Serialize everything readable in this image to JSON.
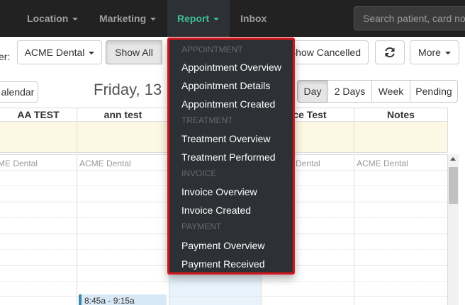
{
  "navbar": {
    "items": [
      {
        "label": "Location"
      },
      {
        "label": "Marketing"
      },
      {
        "label": "Report"
      },
      {
        "label": "Inbox"
      }
    ],
    "search_placeholder": "Search patient, card no"
  },
  "toolbar": {
    "filter_label": "er:",
    "clinic_select": "ACME Dental",
    "show_all": "Show All",
    "show_cancelled": "Show Cancelled",
    "more": "More",
    "refresh_icon": "refresh-icon"
  },
  "calendar": {
    "calendar_button": "alendar",
    "date_title": "Friday, 13",
    "views": [
      "Day",
      "2 Days",
      "Week",
      "Pending"
    ],
    "columns": [
      "AA TEST",
      "ann test",
      "",
      "ctice Test",
      "Notes"
    ],
    "clinic_labels": [
      "ME Dental",
      "ACME Dental",
      "",
      "Dental",
      "ACME Dental"
    ],
    "event_time": "8:45a - 9:15a"
  },
  "report_menu": {
    "sections": [
      {
        "header": "APPOINTMENT",
        "items": [
          "Appointment Overview",
          "Appointment Details",
          "Appointment Created"
        ]
      },
      {
        "header": "TREATMENT",
        "items": [
          "Treatment Overview",
          "Treatment Performed"
        ]
      },
      {
        "header": "INVOICE",
        "items": [
          "Invoice Overview",
          "Invoice Created"
        ]
      },
      {
        "header": "PAYMENT",
        "items": [
          "Payment Overview",
          "Payment Received"
        ]
      }
    ]
  },
  "colors": {
    "navbar_bg": "#222222",
    "active_nav_text": "#3dbf8f",
    "dropdown_bg": "#2d3035",
    "dropdown_border": "#d9151c",
    "allday_bg": "#fcf8e3",
    "event_accent": "#3a87ad"
  }
}
